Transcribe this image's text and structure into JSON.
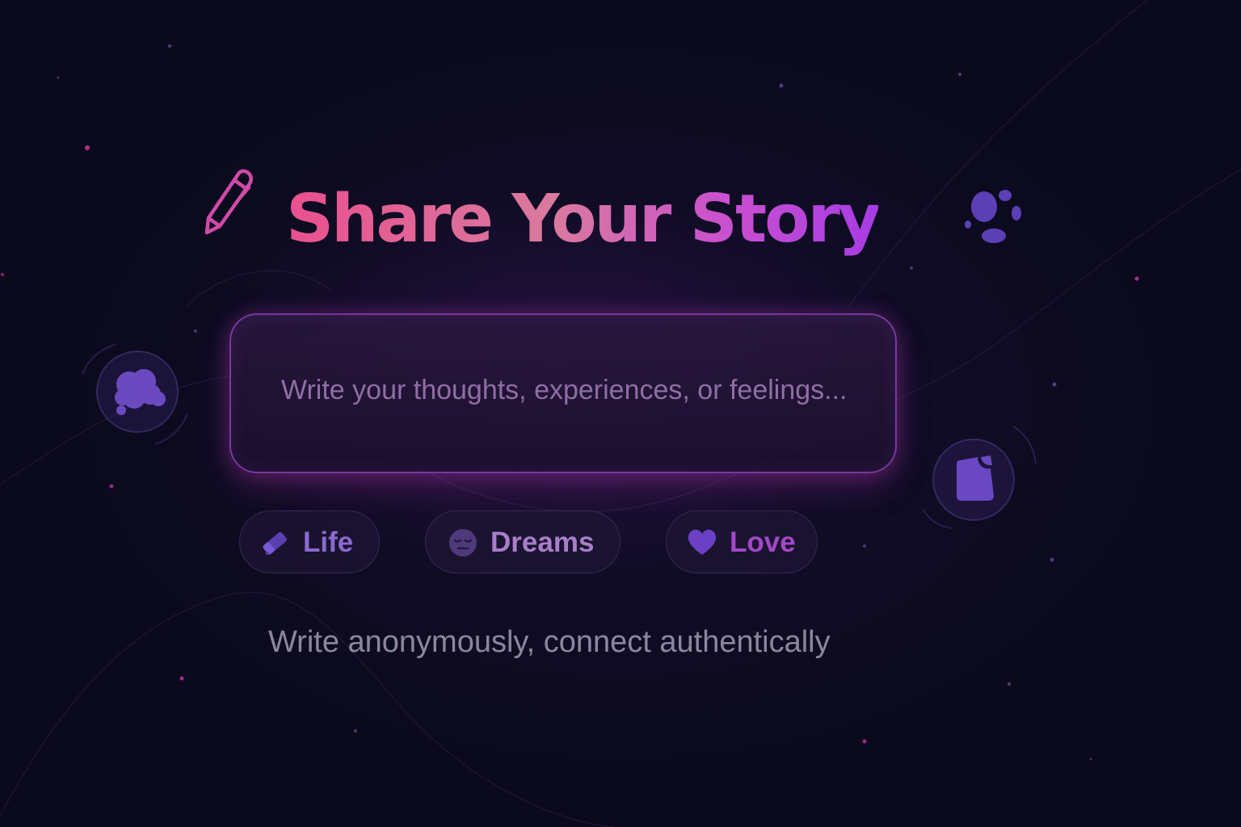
{
  "header": {
    "title": "Share Your Story",
    "icon": "pen-icon"
  },
  "composer": {
    "placeholder": "Write your thoughts, experiences, or feelings...",
    "value": ""
  },
  "tags": [
    {
      "label": "Life",
      "icon": "eraser-icon"
    },
    {
      "label": "Dreams",
      "icon": "sleepy-face-icon"
    },
    {
      "label": "Love",
      "icon": "heart-icon"
    }
  ],
  "tagline": "Write anonymously, connect authentically",
  "decorations": [
    "thought-bubble-icon",
    "paw-print-icon",
    "sticky-note-icon"
  ],
  "colors": {
    "background": "#0b0a1d",
    "title_gradient_start": "#e9508e",
    "title_gradient_end": "#a63ce4",
    "accent_purple": "#6b4ac0",
    "accent_pink": "#d5409f",
    "tagline": "#8d869e"
  }
}
